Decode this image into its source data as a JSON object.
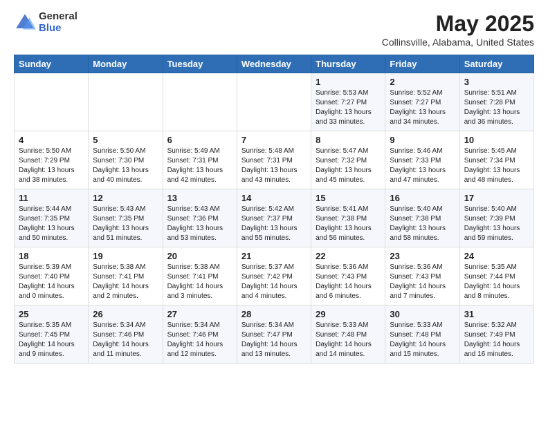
{
  "logo": {
    "general": "General",
    "blue": "Blue"
  },
  "title": "May 2025",
  "subtitle": "Collinsville, Alabama, United States",
  "headers": [
    "Sunday",
    "Monday",
    "Tuesday",
    "Wednesday",
    "Thursday",
    "Friday",
    "Saturday"
  ],
  "weeks": [
    [
      {
        "day": "",
        "sunrise": "",
        "sunset": "",
        "daylight": ""
      },
      {
        "day": "",
        "sunrise": "",
        "sunset": "",
        "daylight": ""
      },
      {
        "day": "",
        "sunrise": "",
        "sunset": "",
        "daylight": ""
      },
      {
        "day": "",
        "sunrise": "",
        "sunset": "",
        "daylight": ""
      },
      {
        "day": "1",
        "sunrise": "Sunrise: 5:53 AM",
        "sunset": "Sunset: 7:27 PM",
        "daylight": "Daylight: 13 hours and 33 minutes."
      },
      {
        "day": "2",
        "sunrise": "Sunrise: 5:52 AM",
        "sunset": "Sunset: 7:27 PM",
        "daylight": "Daylight: 13 hours and 34 minutes."
      },
      {
        "day": "3",
        "sunrise": "Sunrise: 5:51 AM",
        "sunset": "Sunset: 7:28 PM",
        "daylight": "Daylight: 13 hours and 36 minutes."
      }
    ],
    [
      {
        "day": "4",
        "sunrise": "Sunrise: 5:50 AM",
        "sunset": "Sunset: 7:29 PM",
        "daylight": "Daylight: 13 hours and 38 minutes."
      },
      {
        "day": "5",
        "sunrise": "Sunrise: 5:50 AM",
        "sunset": "Sunset: 7:30 PM",
        "daylight": "Daylight: 13 hours and 40 minutes."
      },
      {
        "day": "6",
        "sunrise": "Sunrise: 5:49 AM",
        "sunset": "Sunset: 7:31 PM",
        "daylight": "Daylight: 13 hours and 42 minutes."
      },
      {
        "day": "7",
        "sunrise": "Sunrise: 5:48 AM",
        "sunset": "Sunset: 7:31 PM",
        "daylight": "Daylight: 13 hours and 43 minutes."
      },
      {
        "day": "8",
        "sunrise": "Sunrise: 5:47 AM",
        "sunset": "Sunset: 7:32 PM",
        "daylight": "Daylight: 13 hours and 45 minutes."
      },
      {
        "day": "9",
        "sunrise": "Sunrise: 5:46 AM",
        "sunset": "Sunset: 7:33 PM",
        "daylight": "Daylight: 13 hours and 47 minutes."
      },
      {
        "day": "10",
        "sunrise": "Sunrise: 5:45 AM",
        "sunset": "Sunset: 7:34 PM",
        "daylight": "Daylight: 13 hours and 48 minutes."
      }
    ],
    [
      {
        "day": "11",
        "sunrise": "Sunrise: 5:44 AM",
        "sunset": "Sunset: 7:35 PM",
        "daylight": "Daylight: 13 hours and 50 minutes."
      },
      {
        "day": "12",
        "sunrise": "Sunrise: 5:43 AM",
        "sunset": "Sunset: 7:35 PM",
        "daylight": "Daylight: 13 hours and 51 minutes."
      },
      {
        "day": "13",
        "sunrise": "Sunrise: 5:43 AM",
        "sunset": "Sunset: 7:36 PM",
        "daylight": "Daylight: 13 hours and 53 minutes."
      },
      {
        "day": "14",
        "sunrise": "Sunrise: 5:42 AM",
        "sunset": "Sunset: 7:37 PM",
        "daylight": "Daylight: 13 hours and 55 minutes."
      },
      {
        "day": "15",
        "sunrise": "Sunrise: 5:41 AM",
        "sunset": "Sunset: 7:38 PM",
        "daylight": "Daylight: 13 hours and 56 minutes."
      },
      {
        "day": "16",
        "sunrise": "Sunrise: 5:40 AM",
        "sunset": "Sunset: 7:38 PM",
        "daylight": "Daylight: 13 hours and 58 minutes."
      },
      {
        "day": "17",
        "sunrise": "Sunrise: 5:40 AM",
        "sunset": "Sunset: 7:39 PM",
        "daylight": "Daylight: 13 hours and 59 minutes."
      }
    ],
    [
      {
        "day": "18",
        "sunrise": "Sunrise: 5:39 AM",
        "sunset": "Sunset: 7:40 PM",
        "daylight": "Daylight: 14 hours and 0 minutes."
      },
      {
        "day": "19",
        "sunrise": "Sunrise: 5:38 AM",
        "sunset": "Sunset: 7:41 PM",
        "daylight": "Daylight: 14 hours and 2 minutes."
      },
      {
        "day": "20",
        "sunrise": "Sunrise: 5:38 AM",
        "sunset": "Sunset: 7:41 PM",
        "daylight": "Daylight: 14 hours and 3 minutes."
      },
      {
        "day": "21",
        "sunrise": "Sunrise: 5:37 AM",
        "sunset": "Sunset: 7:42 PM",
        "daylight": "Daylight: 14 hours and 4 minutes."
      },
      {
        "day": "22",
        "sunrise": "Sunrise: 5:36 AM",
        "sunset": "Sunset: 7:43 PM",
        "daylight": "Daylight: 14 hours and 6 minutes."
      },
      {
        "day": "23",
        "sunrise": "Sunrise: 5:36 AM",
        "sunset": "Sunset: 7:43 PM",
        "daylight": "Daylight: 14 hours and 7 minutes."
      },
      {
        "day": "24",
        "sunrise": "Sunrise: 5:35 AM",
        "sunset": "Sunset: 7:44 PM",
        "daylight": "Daylight: 14 hours and 8 minutes."
      }
    ],
    [
      {
        "day": "25",
        "sunrise": "Sunrise: 5:35 AM",
        "sunset": "Sunset: 7:45 PM",
        "daylight": "Daylight: 14 hours and 9 minutes."
      },
      {
        "day": "26",
        "sunrise": "Sunrise: 5:34 AM",
        "sunset": "Sunset: 7:46 PM",
        "daylight": "Daylight: 14 hours and 11 minutes."
      },
      {
        "day": "27",
        "sunrise": "Sunrise: 5:34 AM",
        "sunset": "Sunset: 7:46 PM",
        "daylight": "Daylight: 14 hours and 12 minutes."
      },
      {
        "day": "28",
        "sunrise": "Sunrise: 5:34 AM",
        "sunset": "Sunset: 7:47 PM",
        "daylight": "Daylight: 14 hours and 13 minutes."
      },
      {
        "day": "29",
        "sunrise": "Sunrise: 5:33 AM",
        "sunset": "Sunset: 7:48 PM",
        "daylight": "Daylight: 14 hours and 14 minutes."
      },
      {
        "day": "30",
        "sunrise": "Sunrise: 5:33 AM",
        "sunset": "Sunset: 7:48 PM",
        "daylight": "Daylight: 14 hours and 15 minutes."
      },
      {
        "day": "31",
        "sunrise": "Sunrise: 5:32 AM",
        "sunset": "Sunset: 7:49 PM",
        "daylight": "Daylight: 14 hours and 16 minutes."
      }
    ]
  ]
}
